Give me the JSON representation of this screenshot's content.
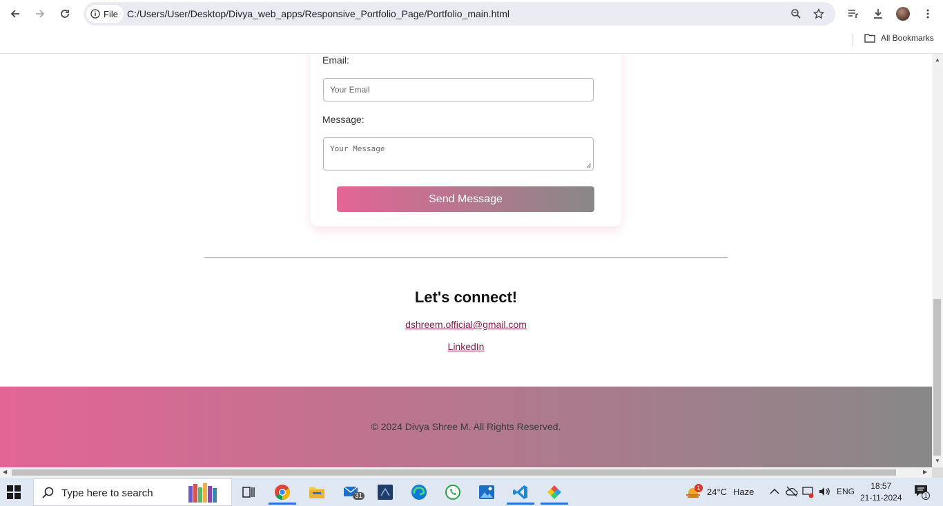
{
  "browser": {
    "chip_label": "File",
    "url": "C:/Users/User/Desktop/Divya_web_apps/Responsive_Portfolio_Page/Portfolio_main.html",
    "all_bookmarks": "All Bookmarks"
  },
  "contact_form": {
    "email_label": "Email:",
    "email_placeholder": "Your Email",
    "message_label": "Message:",
    "message_placeholder": "Your Message",
    "send_label": "Send Message"
  },
  "connect": {
    "title": "Let's connect!",
    "email_link": "dshreem.official@gmail.com",
    "linkedin_link": "LinkedIn"
  },
  "footer": {
    "text": "© 2024 Divya Shree M. All Rights Reserved."
  },
  "colors": {
    "gradient_start": "#e36596",
    "gradient_end": "#888888",
    "link": "#8a1f4e"
  },
  "taskbar": {
    "search_placeholder": "Type here to search",
    "mail_badge": "31",
    "weather_badge": "1",
    "temperature": "24°C",
    "weather": "Haze",
    "language": "ENG",
    "time": "18:57",
    "date": "21-11-2024",
    "notification_count": "1",
    "apps": [
      "task-view",
      "chrome",
      "file-explorer",
      "mail",
      "app-blue",
      "edge",
      "whatsapp",
      "photos",
      "vscode",
      "app-colorful"
    ]
  }
}
